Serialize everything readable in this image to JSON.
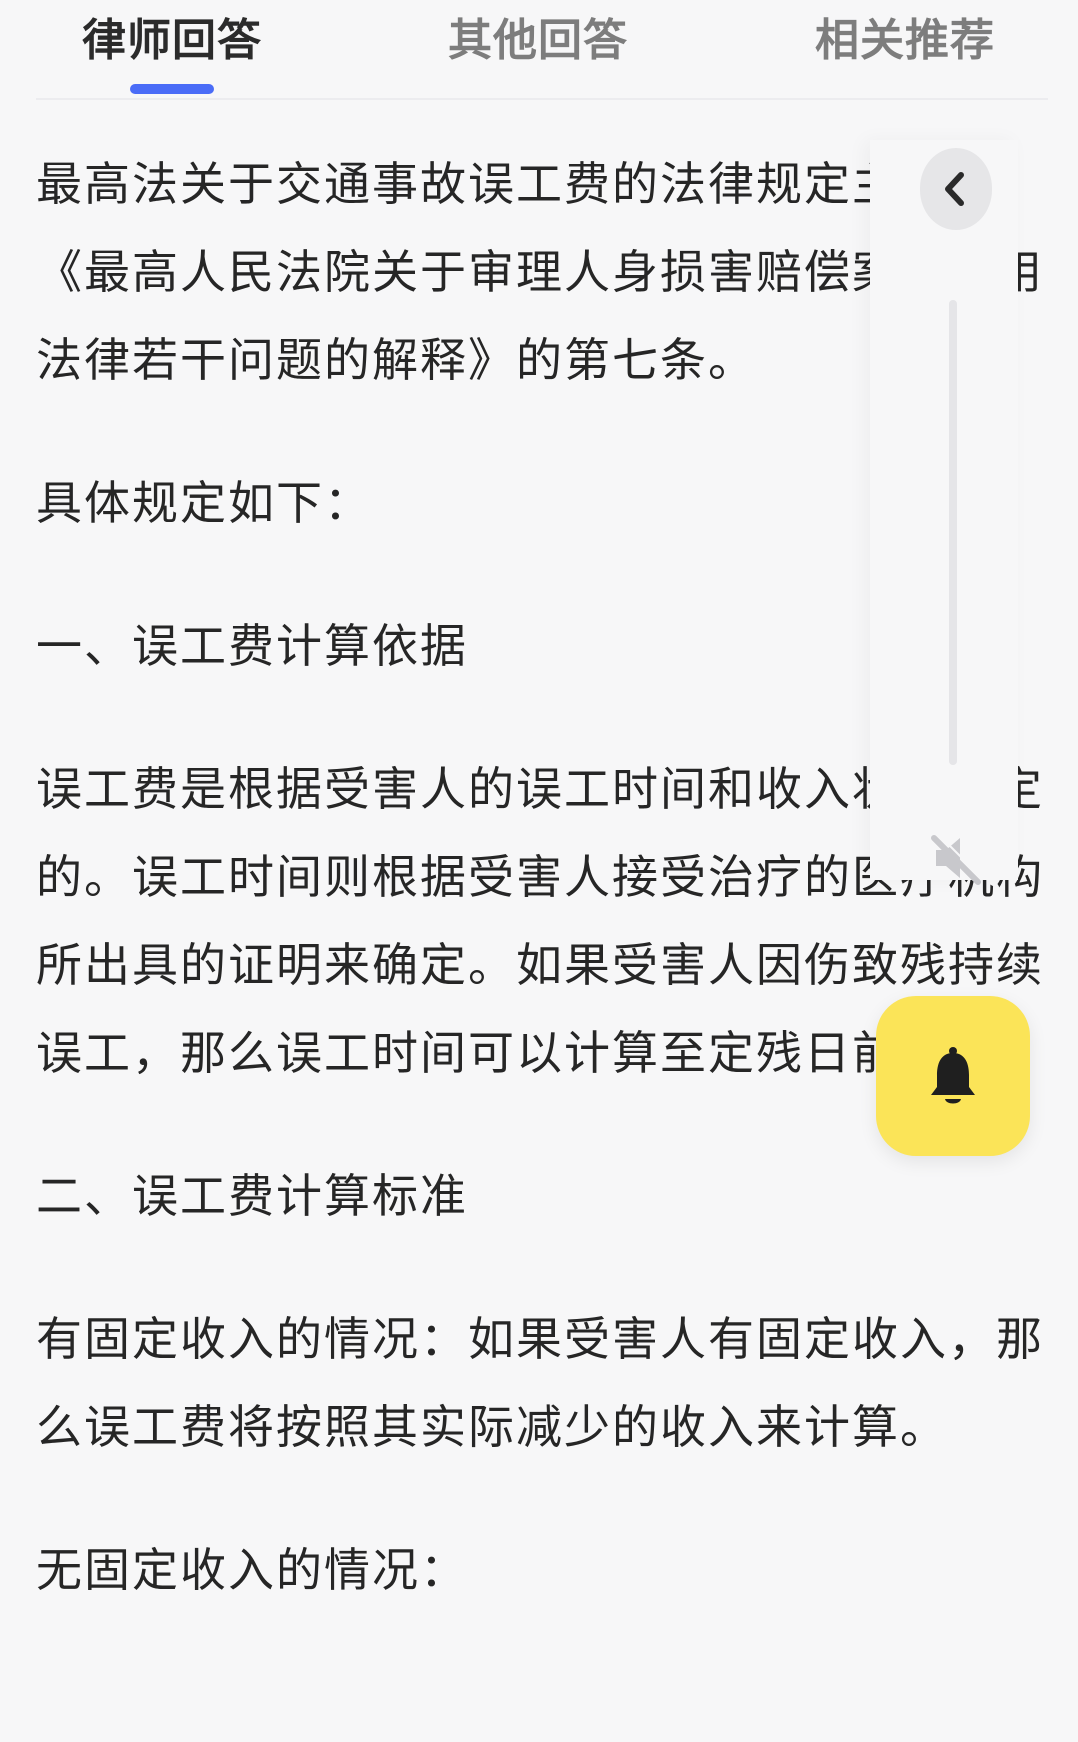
{
  "tabs": [
    {
      "label": "律师回答",
      "active": true
    },
    {
      "label": "其他回答",
      "active": false
    },
    {
      "label": "相关推荐",
      "active": false
    }
  ],
  "colors": {
    "accent": "#4a6cf7",
    "bell_button": "#fbe458",
    "text": "#262626",
    "tab_inactive": "#7d7d7d"
  },
  "article": {
    "paragraphs": [
      "最高法关于交通事故误工费的法律规定主要是《最高人民法院关于审理人身损害赔偿案件适用法律若干问题的解释》的第七条。",
      "具体规定如下：",
      "一、误工费计算依据",
      "误工费是根据受害人的误工时间和收入状况确定的。误工时间则根据受害人接受治疗的医疗机构所出具的证明来确定。如果受害人因伤致残持续误工，那么误工时间可以计算至定残日前一天。",
      "二、误工费计算标准",
      "有固定收入的情况：如果受害人有固定收入，那么误工费将按照其实际减少的收入来计算。",
      "无固定收入的情况："
    ]
  },
  "floating": {
    "collapse_icon": "chevron-left-icon",
    "mute_icon": "speaker-muted-icon",
    "bell_icon": "bell-icon"
  }
}
